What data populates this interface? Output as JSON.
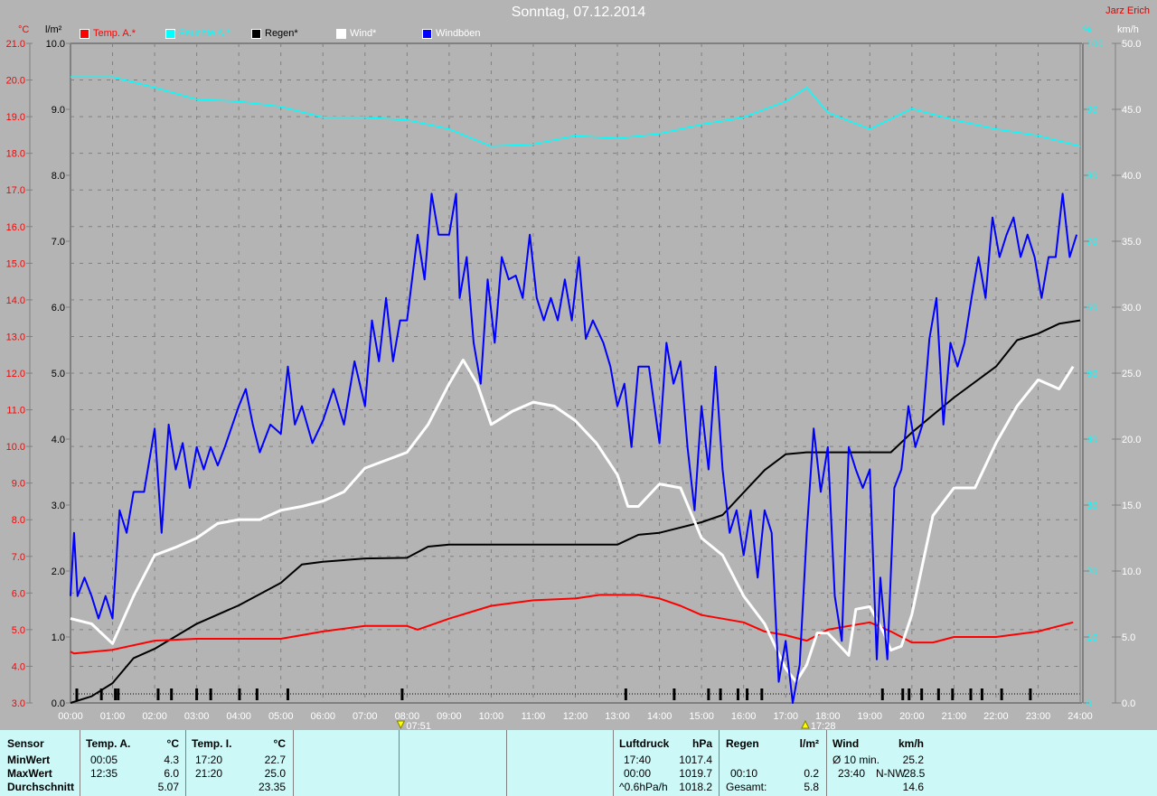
{
  "header": {
    "title": "Sonntag, 07.12.2014",
    "author": "Jarz Erich"
  },
  "legend": [
    {
      "label": "Temp. A.*",
      "color": "#ff0000"
    },
    {
      "label": "Feuchte A.*",
      "color": "#00ffff"
    },
    {
      "label": "Regen*",
      "color": "#000000"
    },
    {
      "label": "Wind*",
      "color": "#ffffff"
    },
    {
      "label": "Windböen",
      "color": "#0000ff"
    }
  ],
  "axes_units": {
    "temp": "°C",
    "rain": "l/m²",
    "hum": "%",
    "wind": "km/h"
  },
  "markers": {
    "sunrise": "07:51",
    "sunset": "17:28"
  },
  "chart_data": {
    "type": "line",
    "title": "Sonntag, 07.12.2014",
    "x_ticks": [
      "00:00",
      "01:00",
      "02:00",
      "03:00",
      "04:00",
      "05:00",
      "06:00",
      "07:00",
      "08:00",
      "09:00",
      "10:00",
      "11:00",
      "12:00",
      "13:00",
      "14:00",
      "15:00",
      "16:00",
      "17:00",
      "18:00",
      "19:00",
      "20:00",
      "21:00",
      "22:00",
      "23:00",
      "24:00"
    ],
    "temp_ticks": [
      "21.0",
      "20.0",
      "19.0",
      "18.0",
      "17.0",
      "16.0",
      "15.0",
      "14.0",
      "13.0",
      "12.0",
      "11.0",
      "10.0",
      "9.0",
      "8.0",
      "7.0",
      "6.0",
      "5.0",
      "4.0",
      "3.0"
    ],
    "rain_ticks": [
      "10.0",
      "9.0",
      "8.0",
      "7.0",
      "6.0",
      "5.0",
      "4.0",
      "3.0",
      "2.0",
      "1.0",
      "0.0"
    ],
    "hum_ticks": [
      "100",
      "90",
      "80",
      "70",
      "60",
      "50",
      "40",
      "30",
      "20",
      "10",
      "0"
    ],
    "wind_ticks": [
      "50.0",
      "45.0",
      "40.0",
      "35.0",
      "30.0",
      "25.0",
      "20.0",
      "15.0",
      "10.0",
      "5.0",
      "0.0"
    ],
    "ylim_temp": [
      3,
      21
    ],
    "ylim_rain": [
      0,
      10
    ],
    "ylim_hum": [
      0,
      100
    ],
    "ylim_wind": [
      0,
      50
    ],
    "series": [
      {
        "name": "Temp. A.",
        "unit": "°C",
        "axis": "temp",
        "color": "#ff0000",
        "t": [
          "00:00",
          "00:05",
          "01:00",
          "02:00",
          "03:00",
          "05:00",
          "06:00",
          "07:00",
          "08:00",
          "08:15",
          "09:00",
          "10:00",
          "11:00",
          "12:00",
          "12:35",
          "13:30",
          "14:00",
          "14:30",
          "15:00",
          "16:00",
          "16:30",
          "17:00",
          "17:30",
          "18:00",
          "18:30",
          "19:00",
          "19:30",
          "20:00",
          "20:30",
          "21:00",
          "22:00",
          "23:00",
          "23:50"
        ],
        "v": [
          4.4,
          4.35,
          4.45,
          4.7,
          4.75,
          4.75,
          4.95,
          5.1,
          5.1,
          5.0,
          5.3,
          5.65,
          5.8,
          5.85,
          5.95,
          5.95,
          5.85,
          5.65,
          5.4,
          5.2,
          4.95,
          4.85,
          4.7,
          5.0,
          5.1,
          5.2,
          4.95,
          4.65,
          4.65,
          4.8,
          4.8,
          4.95,
          5.2
        ]
      },
      {
        "name": "Feuchte A.",
        "unit": "%",
        "axis": "hum",
        "color": "#00ffff",
        "t": [
          "00:00",
          "01:00",
          "02:00",
          "03:00",
          "04:00",
          "05:00",
          "06:00",
          "07:00",
          "08:00",
          "09:00",
          "10:00",
          "11:00",
          "12:00",
          "13:00",
          "14:00",
          "15:00",
          "16:00",
          "17:00",
          "17:30",
          "18:00",
          "19:00",
          "20:00",
          "21:00",
          "22:00",
          "23:00",
          "24:00"
        ],
        "v": [
          94.9,
          94.9,
          93.3,
          91.5,
          91.2,
          90.4,
          88.8,
          88.8,
          88.4,
          87.0,
          84.4,
          84.7,
          86.0,
          85.6,
          86.3,
          87.7,
          88.8,
          91.2,
          93.3,
          89.5,
          87.0,
          90.1,
          88.4,
          87.0,
          86.0,
          84.4
        ]
      },
      {
        "name": "Regen",
        "unit": "l/m²",
        "axis": "rain",
        "color": "#000000",
        "t": [
          "00:00",
          "00:30",
          "01:00",
          "01:30",
          "02:00",
          "03:00",
          "04:00",
          "05:00",
          "05:30",
          "06:00",
          "07:00",
          "08:00",
          "08:30",
          "09:00",
          "13:00",
          "13:30",
          "14:00",
          "15:00",
          "15:30",
          "16:00",
          "16:30",
          "17:00",
          "17:30",
          "19:30",
          "20:00",
          "21:00",
          "22:00",
          "22:30",
          "23:00",
          "23:30",
          "24:00"
        ],
        "v": [
          0,
          0.1,
          0.3,
          0.68,
          0.82,
          1.2,
          1.48,
          1.82,
          2.1,
          2.14,
          2.19,
          2.2,
          2.37,
          2.4,
          2.4,
          2.55,
          2.58,
          2.74,
          2.85,
          3.19,
          3.53,
          3.77,
          3.8,
          3.8,
          4.1,
          4.63,
          5.1,
          5.5,
          5.6,
          5.75,
          5.8
        ]
      },
      {
        "name": "Wind",
        "unit": "km/h",
        "axis": "wind",
        "color": "#ffffff",
        "t": [
          "00:00",
          "00:30",
          "01:00",
          "01:30",
          "02:00",
          "02:30",
          "03:00",
          "03:30",
          "04:00",
          "04:30",
          "05:00",
          "05:30",
          "06:00",
          "06:30",
          "07:00",
          "07:30",
          "08:00",
          "08:30",
          "09:00",
          "09:20",
          "09:40",
          "10:00",
          "10:30",
          "11:00",
          "11:30",
          "12:00",
          "12:30",
          "13:00",
          "13:15",
          "13:30",
          "14:00",
          "14:30",
          "15:00",
          "15:30",
          "16:00",
          "16:30",
          "17:00",
          "17:15",
          "17:30",
          "17:45",
          "18:00",
          "18:30",
          "18:40",
          "19:00",
          "19:20",
          "19:30",
          "19:45",
          "20:00",
          "20:30",
          "21:00",
          "21:30",
          "22:00",
          "22:30",
          "23:00",
          "23:30",
          "23:50"
        ],
        "v": [
          6.4,
          6.0,
          4.5,
          8.1,
          11.2,
          11.8,
          12.5,
          13.6,
          13.9,
          13.9,
          14.6,
          14.9,
          15.3,
          16.0,
          17.8,
          18.4,
          19.0,
          21.1,
          24.2,
          26.0,
          24.2,
          21.1,
          22.1,
          22.8,
          22.5,
          21.4,
          19.7,
          17.3,
          14.9,
          14.9,
          16.6,
          16.3,
          12.5,
          11.2,
          8.1,
          6.0,
          2.6,
          1.6,
          2.9,
          5.3,
          5.3,
          3.6,
          7.1,
          7.3,
          5.3,
          4.0,
          4.3,
          6.7,
          14.2,
          16.3,
          16.3,
          19.7,
          22.5,
          24.5,
          23.8,
          25.5
        ]
      },
      {
        "name": "Windböen",
        "unit": "km/h",
        "axis": "wind",
        "color": "#0000ff",
        "t": [
          "00:00",
          "00:05",
          "00:10",
          "00:20",
          "00:30",
          "00:40",
          "00:50",
          "01:00",
          "01:10",
          "01:20",
          "01:30",
          "01:45",
          "02:00",
          "02:10",
          "02:20",
          "02:30",
          "02:40",
          "02:50",
          "03:00",
          "03:10",
          "03:20",
          "03:30",
          "03:40",
          "04:00",
          "04:10",
          "04:20",
          "04:30",
          "04:45",
          "05:00",
          "05:10",
          "05:20",
          "05:30",
          "05:45",
          "06:00",
          "06:15",
          "06:30",
          "06:45",
          "07:00",
          "07:10",
          "07:20",
          "07:30",
          "07:40",
          "07:50",
          "08:00",
          "08:15",
          "08:25",
          "08:35",
          "08:45",
          "09:00",
          "09:10",
          "09:15",
          "09:25",
          "09:35",
          "09:45",
          "09:55",
          "10:05",
          "10:15",
          "10:25",
          "10:35",
          "10:45",
          "10:55",
          "11:05",
          "11:15",
          "11:25",
          "11:35",
          "11:45",
          "11:55",
          "12:05",
          "12:15",
          "12:25",
          "12:40",
          "12:50",
          "13:00",
          "13:10",
          "13:20",
          "13:30",
          "13:45",
          "14:00",
          "14:10",
          "14:20",
          "14:30",
          "14:40",
          "14:50",
          "15:00",
          "15:10",
          "15:20",
          "15:30",
          "15:40",
          "15:50",
          "16:00",
          "16:10",
          "16:20",
          "16:30",
          "16:40",
          "16:50",
          "17:00",
          "17:10",
          "17:20",
          "17:30",
          "17:40",
          "17:50",
          "18:00",
          "18:10",
          "18:20",
          "18:30",
          "18:40",
          "18:50",
          "19:00",
          "19:10",
          "19:15",
          "19:25",
          "19:35",
          "19:45",
          "19:55",
          "20:05",
          "20:15",
          "20:25",
          "20:35",
          "20:45",
          "20:55",
          "21:05",
          "21:15",
          "21:25",
          "21:35",
          "21:45",
          "21:55",
          "22:05",
          "22:15",
          "22:25",
          "22:35",
          "22:45",
          "22:55",
          "23:05",
          "23:15",
          "23:25",
          "23:35",
          "23:45",
          "23:55"
        ],
        "v": [
          8.1,
          12.9,
          8.1,
          9.5,
          8.1,
          6.4,
          8.1,
          6.4,
          14.6,
          12.9,
          16.0,
          16.0,
          20.8,
          12.9,
          21.1,
          17.7,
          19.7,
          16.3,
          19.4,
          17.7,
          19.4,
          18.0,
          19.4,
          22.5,
          23.8,
          21.1,
          19.0,
          21.1,
          20.4,
          25.5,
          21.1,
          22.5,
          19.7,
          21.4,
          23.8,
          21.1,
          25.9,
          22.5,
          29.0,
          25.9,
          30.7,
          25.9,
          29.0,
          29.0,
          35.5,
          32.1,
          38.6,
          35.5,
          35.5,
          38.6,
          30.7,
          33.8,
          27.3,
          24.2,
          32.1,
          27.3,
          33.8,
          32.1,
          32.4,
          30.7,
          35.5,
          30.7,
          29.0,
          30.7,
          29.0,
          32.1,
          29.0,
          33.8,
          27.6,
          29.0,
          27.3,
          25.5,
          22.5,
          24.2,
          19.4,
          25.5,
          25.5,
          19.7,
          27.3,
          24.2,
          25.9,
          19.4,
          14.6,
          22.5,
          17.7,
          25.5,
          17.7,
          12.9,
          14.6,
          11.2,
          14.6,
          9.5,
          14.6,
          12.9,
          1.6,
          4.7,
          0,
          2.9,
          12.9,
          20.8,
          16.0,
          19.4,
          8.1,
          4.7,
          19.4,
          17.7,
          16.3,
          17.7,
          3.3,
          9.5,
          3.3,
          16.3,
          17.7,
          22.5,
          19.4,
          21.1,
          27.6,
          30.7,
          21.1,
          27.3,
          25.5,
          27.3,
          30.7,
          33.8,
          30.7,
          36.8,
          33.8,
          35.5,
          36.8,
          33.8,
          35.5,
          33.8,
          30.7,
          33.8,
          33.8,
          38.6,
          33.8,
          35.5
        ]
      }
    ],
    "rain_events": [
      "00:09",
      "00:44",
      "01:04",
      "01:08",
      "02:05",
      "02:24",
      "03:00",
      "03:20",
      "04:01",
      "04:26",
      "05:10",
      "07:53",
      "13:12",
      "14:21",
      "15:10",
      "15:27",
      "15:52",
      "16:05",
      "16:26",
      "19:18",
      "19:47",
      "19:56",
      "20:14",
      "20:38",
      "20:58",
      "21:24",
      "21:40",
      "22:08",
      "22:49"
    ]
  },
  "table": {
    "sensor": {
      "header": "Sensor",
      "rows": [
        "MinWert",
        "MaxWert",
        "Durchschnitt"
      ]
    },
    "temp_a": {
      "header": "Temp. A.",
      "unit": "°C",
      "min_time": "00:05",
      "min": "4.3",
      "max_time": "12:35",
      "max": "6.0",
      "avg": "5.07"
    },
    "temp_i": {
      "header": "Temp. I.",
      "unit": "°C",
      "min_time": "17:20",
      "min": "22.7",
      "max_time": "21:20",
      "max": "25.0",
      "avg": "23.35"
    },
    "pressure": {
      "header": "Luftdruck",
      "unit": "hPa",
      "min_time": "17:40",
      "min": "1017.4",
      "max_time": "00:00",
      "max": "1019.7",
      "trend": "^0.6hPa/h",
      "avg": "1018.2"
    },
    "rain": {
      "header": "Regen",
      "unit": "l/m²",
      "max_time": "00:10",
      "max": "0.2",
      "total_label": "Gesamt:",
      "total": "5.8"
    },
    "wind": {
      "header": "Wind",
      "unit": "km/h",
      "avg10_label": "Ø 10 min.",
      "avg10": "25.2",
      "max_time": "23:40",
      "max_dir": "N-NW",
      "max": "28.5",
      "avg": "14.6"
    }
  }
}
